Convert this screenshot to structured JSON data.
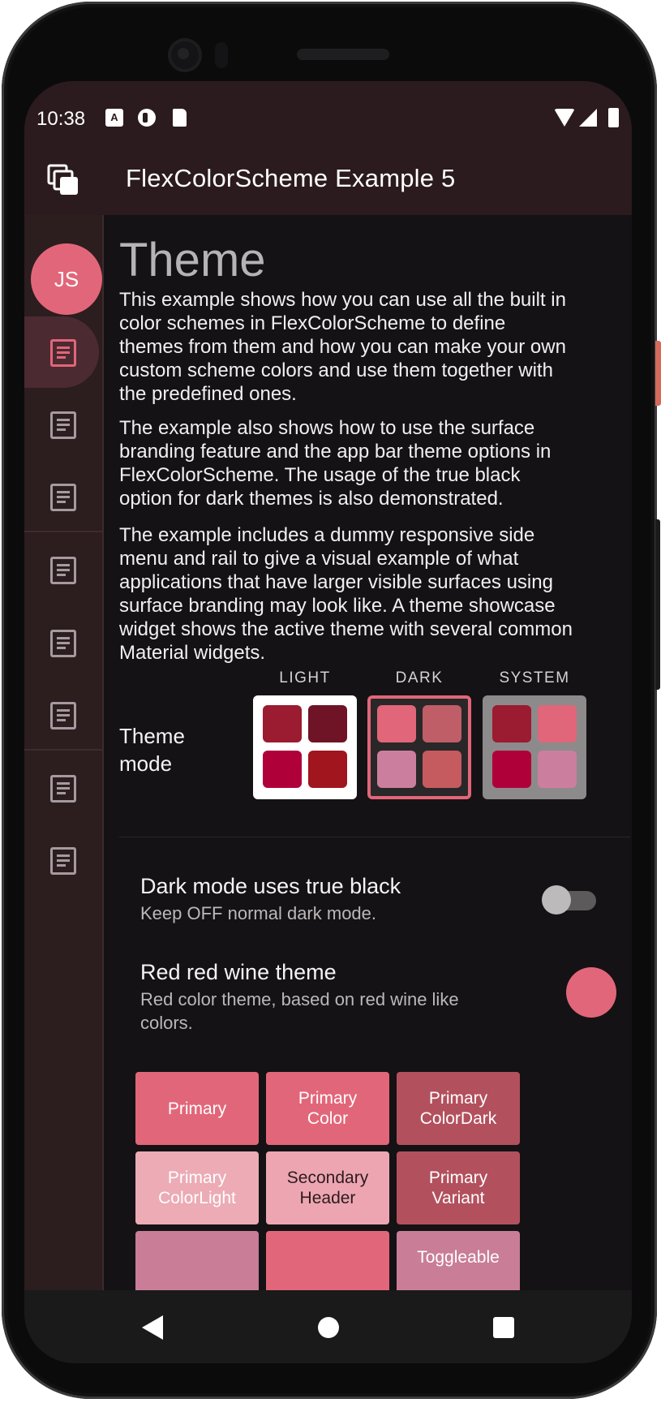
{
  "status_bar": {
    "time": "10:38",
    "notif_a": "A"
  },
  "app_bar": {
    "title": "FlexColorScheme Example 5"
  },
  "rail": {
    "avatar_initials": "JS"
  },
  "content": {
    "heading": "Theme",
    "paragraphs": [
      "This example shows how you can use all the built in color schemes in FlexColorScheme to define themes from them and how you can make your own custom scheme colors and use them together with the predefined ones.",
      "The example also shows how to use the surface branding feature and the app bar theme options in FlexColorScheme. The usage of the true black option for dark themes is also demonstrated.",
      "The example includes a dummy responsive side menu and rail to give a visual example of what applications that have larger visible surfaces using surface branding may look like. A theme showcase widget shows the active theme with several common Material widgets."
    ],
    "theme_mode": {
      "label": "Theme mode",
      "options": [
        "LIGHT",
        "DARK",
        "SYSTEM"
      ]
    },
    "true_black": {
      "title": "Dark mode uses true black",
      "subtitle": "Keep OFF normal dark mode."
    },
    "scheme": {
      "title": "Red red wine theme",
      "subtitle": "Red color theme, based on red wine like colors."
    },
    "buttons": [
      "Primary",
      "Primary\nColor",
      "Primary\nColorDark",
      "Primary\nColorLight",
      "Secondary\nHeader",
      "Primary\nVariant",
      "",
      "",
      "Toggleable"
    ]
  },
  "colors": {
    "accent": "#e26679",
    "light_swatches": [
      "#9b1b30",
      "#6f1326",
      "#b0003a",
      "#a0151e"
    ],
    "dark_swatches": [
      "#e26679",
      "#c05e68",
      "#cc7e9e",
      "#c55b5f"
    ],
    "system_swatches": [
      "#9b1b30",
      "#e26679",
      "#b0003a",
      "#cc7e9e"
    ],
    "button_colors": [
      "#e26679",
      "#e26679",
      "#b3505d",
      "#ecabb5",
      "#eda6b1",
      "#b3505d",
      "#c97d96",
      "#e26679",
      "#c97d96"
    ]
  }
}
